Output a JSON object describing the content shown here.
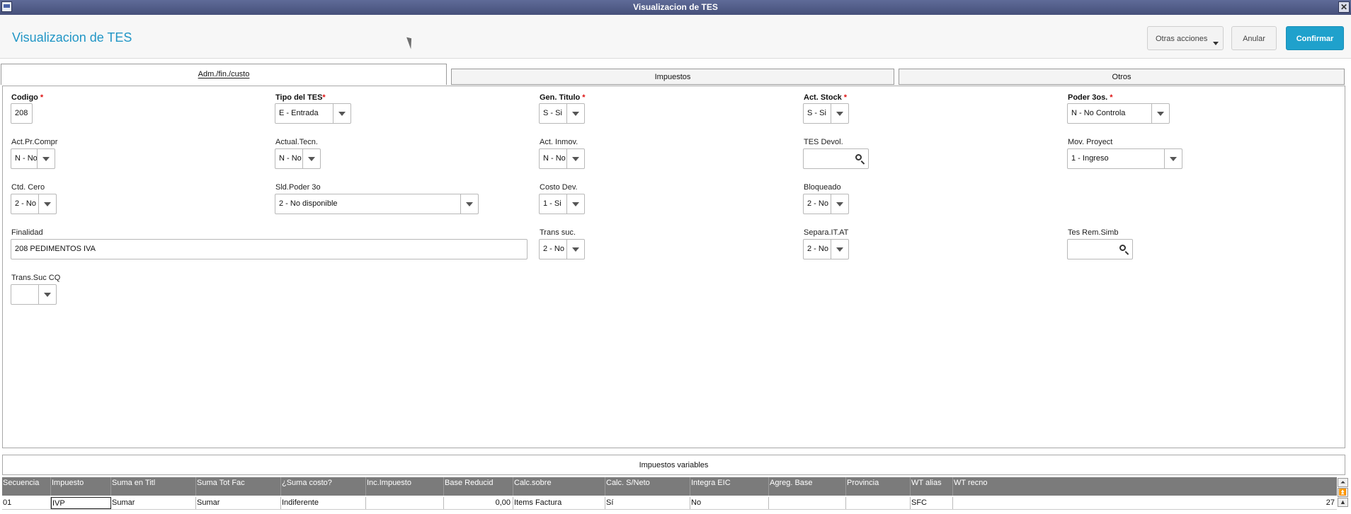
{
  "window": {
    "title": "Visualizacion de TES"
  },
  "header": {
    "title": "Visualizacion de TES",
    "buttons": {
      "otras_acciones": "Otras acciones",
      "anular": "Anular",
      "confirmar": "Confirmar"
    }
  },
  "tabs": [
    {
      "label": "Adm./fin./custo",
      "active": true
    },
    {
      "label": "Impuestos",
      "active": false
    },
    {
      "label": "Otros",
      "active": false
    }
  ],
  "form": {
    "codigo": {
      "label": "Codigo",
      "value": "208"
    },
    "tipo_tes": {
      "label": "Tipo del TES",
      "value": "E - Entrada"
    },
    "gen_titulo": {
      "label": "Gen. Titulo",
      "value": "S - Si"
    },
    "act_stock": {
      "label": "Act. Stock",
      "value": "S - Si"
    },
    "poder_3os": {
      "label": "Poder 3os.",
      "value": "N - No Controla"
    },
    "act_pr_compr": {
      "label": "Act.Pr.Compr",
      "value": "N - No"
    },
    "actual_tecn": {
      "label": "Actual.Tecn.",
      "value": "N - No"
    },
    "act_inmov": {
      "label": "Act. Inmov.",
      "value": "N - No"
    },
    "tes_devol": {
      "label": "TES Devol.",
      "value": ""
    },
    "mov_proyect": {
      "label": "Mov. Proyect",
      "value": "1 - Ingreso"
    },
    "ctd_cero": {
      "label": "Ctd. Cero",
      "value": "2 - No"
    },
    "sld_poder_3o": {
      "label": "Sld.Poder 3o",
      "value": "2 - No disponible"
    },
    "costo_dev": {
      "label": "Costo Dev.",
      "value": "1 - Si"
    },
    "bloqueado": {
      "label": "Bloqueado",
      "value": "2 - No"
    },
    "finalidad": {
      "label": "Finalidad",
      "value": "208 PEDIMENTOS IVA"
    },
    "trans_suc": {
      "label": "Trans suc.",
      "value": "2 - No"
    },
    "separa_it_at": {
      "label": "Separa.IT.AT",
      "value": "2 - No"
    },
    "tes_rem_simb": {
      "label": "Tes Rem.Simb",
      "value": ""
    },
    "trans_suc_cq": {
      "label": "Trans.Suc CQ",
      "value": ""
    }
  },
  "grid": {
    "title": "Impuestos variables",
    "columns": [
      "Secuencia",
      "Impuesto",
      "Suma en Titl",
      "Suma Tot Fac",
      "¿Suma costo?",
      "Inc.Impuesto",
      "Base Reducid",
      "Calc.sobre",
      "Calc. S/Neto",
      "Integra EIC",
      "Agreg. Base",
      "Provincia",
      "WT alias",
      "WT recno"
    ],
    "rows": [
      [
        "01",
        "IVP",
        "Sumar",
        "Sumar",
        "Indiferente",
        "",
        "0,00",
        "Items Factura",
        "Sí",
        "No",
        "",
        "",
        "SFC",
        "27"
      ]
    ]
  },
  "colors": {
    "accent": "#2196c6",
    "confirm": "#1fa1cc",
    "titlebar": "#4f5a87",
    "grid_header": "#7b7b7b"
  }
}
